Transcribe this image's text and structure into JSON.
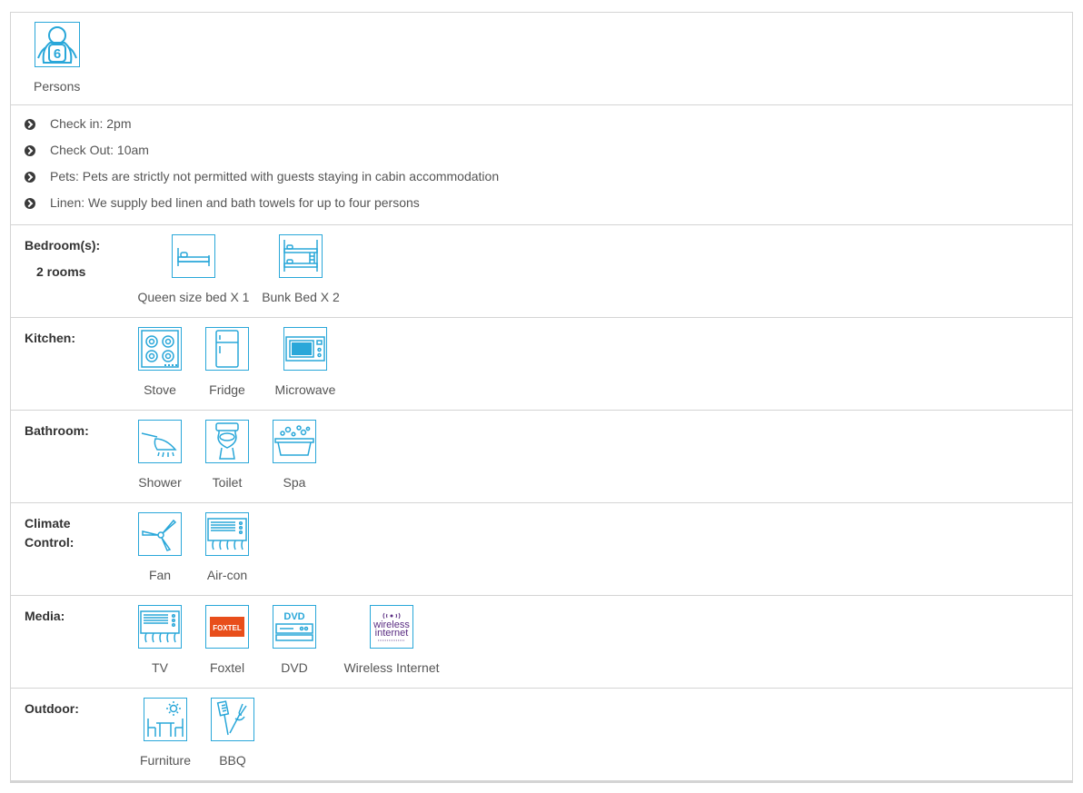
{
  "capacity": {
    "count": "6",
    "label": "Persons",
    "icon": "person-icon"
  },
  "rules": [
    "Check in: 2pm",
    "Check Out: 10am",
    "Pets: Pets are strictly not permitted with guests staying in cabin accommodation",
    "Linen: We supply bed linen and bath towels for up to four persons"
  ],
  "categories": {
    "bedroom": {
      "title": "Bedroom(s):",
      "sub": "2 rooms",
      "items": [
        {
          "label": "Queen size bed X 1",
          "icon": "queen-bed-icon"
        },
        {
          "label": "Bunk Bed X 2",
          "icon": "bunk-bed-icon"
        }
      ]
    },
    "kitchen": {
      "title": "Kitchen:",
      "items": [
        {
          "label": "Stove",
          "icon": "stove-icon"
        },
        {
          "label": "Fridge",
          "icon": "fridge-icon"
        },
        {
          "label": "Microwave",
          "icon": "microwave-icon"
        }
      ]
    },
    "bathroom": {
      "title": "Bathroom:",
      "items": [
        {
          "label": "Shower",
          "icon": "shower-icon"
        },
        {
          "label": "Toilet",
          "icon": "toilet-icon"
        },
        {
          "label": "Spa",
          "icon": "spa-icon"
        }
      ]
    },
    "climate": {
      "title_line1": "Climate",
      "title_line2": "Control:",
      "items": [
        {
          "label": "Fan",
          "icon": "fan-icon"
        },
        {
          "label": "Air-con",
          "icon": "air-con-icon"
        }
      ]
    },
    "media": {
      "title": "Media:",
      "items": [
        {
          "label": "TV",
          "icon": "tv-icon"
        },
        {
          "label": "Foxtel",
          "icon": "foxtel-icon",
          "logo_text": "FOXTEL"
        },
        {
          "label": "DVD",
          "icon": "dvd-icon",
          "logo_text": "DVD"
        },
        {
          "label": "Wireless Internet",
          "icon": "wireless-internet-icon",
          "logo_text_1": "wireless",
          "logo_text_2": "internet"
        }
      ]
    },
    "outdoor": {
      "title": "Outdoor:",
      "items": [
        {
          "label": "Furniture",
          "icon": "outdoor-furniture-icon"
        },
        {
          "label": "BBQ",
          "icon": "bbq-icon"
        }
      ]
    }
  },
  "colors": {
    "accent": "#29a7d9",
    "text": "#555555",
    "heading": "#333333",
    "border": "#d4d4d4",
    "foxtel": "#e84e1b",
    "wireless": "#5a2d82"
  }
}
